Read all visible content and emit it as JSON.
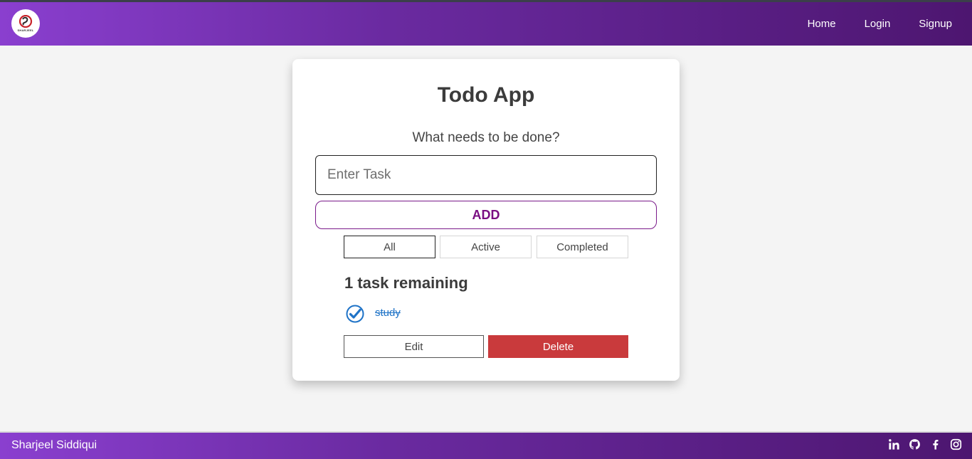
{
  "navbar": {
    "logo_text": "SHARJEEL",
    "links": [
      {
        "label": "Home"
      },
      {
        "label": "Login"
      },
      {
        "label": "Signup"
      }
    ]
  },
  "todo": {
    "title": "Todo App",
    "subtitle": "What needs to be done?",
    "input_placeholder": "Enter Task",
    "input_value": "",
    "add_label": "ADD",
    "filters": [
      {
        "label": "All",
        "selected": true
      },
      {
        "label": "Active",
        "selected": false
      },
      {
        "label": "Completed",
        "selected": false
      }
    ],
    "remaining_text": "1 task remaining",
    "tasks": [
      {
        "text": "study",
        "completed": true,
        "edit_label": "Edit",
        "delete_label": "Delete"
      }
    ]
  },
  "footer": {
    "name": "Sharjeel Siddiqui",
    "social_icons": [
      "linkedin-icon",
      "github-icon",
      "facebook-icon",
      "instagram-icon"
    ]
  },
  "colors": {
    "navbar_gradient_start": "#8a3fcf",
    "navbar_gradient_end": "#4d1670",
    "add_button_accent": "#7a0f82",
    "delete_button": "#c93a3c",
    "completed_task_text": "#1f73c7"
  }
}
